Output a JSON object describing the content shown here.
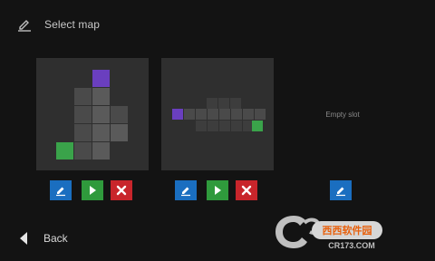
{
  "header": {
    "title": "Select map",
    "icon": "edit-icon"
  },
  "slots": [
    {
      "name": "map-slot-1",
      "filled": true,
      "buttons": [
        "edit",
        "play",
        "delete"
      ]
    },
    {
      "name": "map-slot-2",
      "filled": true,
      "buttons": [
        "edit",
        "play",
        "delete"
      ]
    },
    {
      "name": "map-slot-3",
      "filled": false,
      "empty_label": "Empty slot",
      "buttons": [
        "edit"
      ]
    }
  ],
  "colors": {
    "background": "#131313",
    "slot": "#2f2f2f",
    "tile": "#4a4a4a",
    "tile_light": "#5a5a5a",
    "start": "#3aa34a",
    "end": "#6a3fbf",
    "edit_button": "#1a6ec0",
    "play_button": "#2f9a3c",
    "delete_button": "#c8252b"
  },
  "footer": {
    "back_label": "Back",
    "back_icon": "back-triangle-icon"
  },
  "watermark": {
    "logo_text": "西西软件园",
    "url_text": "CR173.COM"
  }
}
